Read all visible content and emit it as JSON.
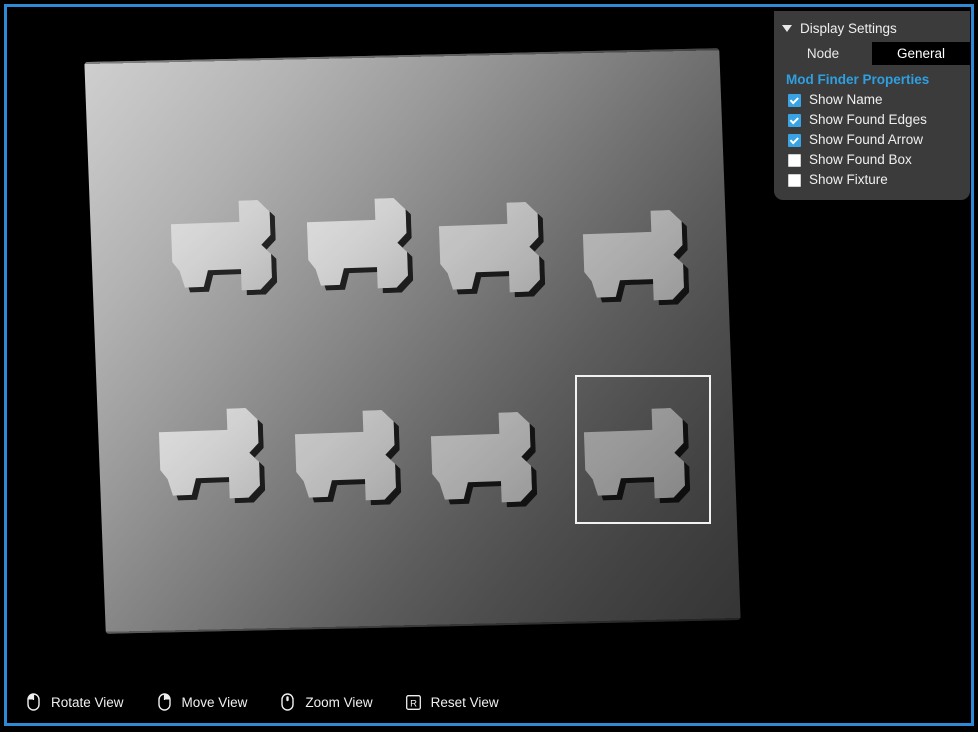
{
  "window": {
    "border_color": "#2e8ad4",
    "background": "#000000"
  },
  "scene": {
    "type": "3d-depth-point-cloud",
    "description": "Depth-map point cloud of eight T-shaped pipe fittings arranged in a 4x2 grid on a flat plate",
    "part_count": 8,
    "parts": [
      {
        "id": "part-1",
        "row": 1,
        "col": 1
      },
      {
        "id": "part-2",
        "row": 1,
        "col": 2
      },
      {
        "id": "part-3",
        "row": 1,
        "col": 3
      },
      {
        "id": "part-4",
        "row": 1,
        "col": 4
      },
      {
        "id": "part-5",
        "row": 2,
        "col": 1
      },
      {
        "id": "part-6",
        "row": 2,
        "col": 2
      },
      {
        "id": "part-7",
        "row": 2,
        "col": 3
      },
      {
        "id": "part-8",
        "row": 2,
        "col": 4,
        "selected": true
      }
    ],
    "found_box": {
      "visible": true,
      "color": "#f2f2f2",
      "target_part": "part-8"
    }
  },
  "toolbar": {
    "items": [
      {
        "icon": "mouse-left-button-icon",
        "label": "Rotate View"
      },
      {
        "icon": "mouse-right-button-icon",
        "label": "Move View"
      },
      {
        "icon": "mouse-wheel-icon",
        "label": "Zoom View"
      },
      {
        "icon": "key-r-icon",
        "label": "Reset View"
      }
    ]
  },
  "display_settings": {
    "title": "Display Settings",
    "collapse_icon": "triangle-down-icon",
    "expanded": true,
    "tabs": [
      {
        "label": "Node",
        "active": false
      },
      {
        "label": "General",
        "active": true
      }
    ],
    "section_title": "Mod Finder Properties",
    "section_title_color": "#2e9fe0",
    "options": [
      {
        "label": "Show Name",
        "checked": true
      },
      {
        "label": "Show Found Edges",
        "checked": true
      },
      {
        "label": "Show Found Arrow",
        "checked": true
      },
      {
        "label": "Show Found Box",
        "checked": false
      },
      {
        "label": "Show Fixture",
        "checked": false
      }
    ]
  }
}
